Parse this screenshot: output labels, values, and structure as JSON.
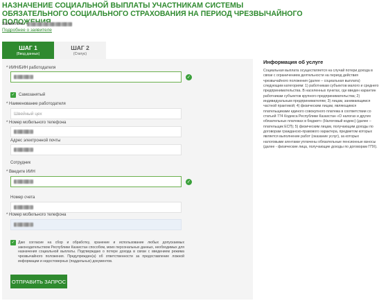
{
  "page": {
    "title": "НАЗНАЧЕНИЕ СОЦИАЛЬНОЙ ВЫПЛАТЫ УЧАСТНИКАМ СИСТЕМЫ ОБЯЗАТЕЛЬНОГО СОЦИАЛЬНОГО СТРАХОВАНИЯ НА ПЕРИОД ЧРЕЗВЫЧАЙНОГО ПОЛОЖЕНИЯ",
    "applicant_label": "Заявитель:",
    "more_link": "Подробнее о заявителе"
  },
  "tabs": [
    {
      "label": "ШАГ 1",
      "sub": "(Ввод данных)",
      "active": true
    },
    {
      "label": "ШАГ 2",
      "sub": "(Статус)",
      "active": false
    }
  ],
  "form": {
    "employer_iin_label": "ИИН/БИН работодателя",
    "self_employed_label": "Самозанятый",
    "employer_name_label": "Наименование работодателя",
    "employer_name_value": "Швейный цех",
    "employer_phone_label": "Номер мобильного телефона",
    "employer_email_label": "Адрес электронной почты",
    "employee_section": "Сотрудник",
    "iin_label": "Введите ИИН",
    "account_label": "Номер счета",
    "phone_label": "Номер мобильного телефона",
    "consent_text": "Даю согласие на сбор и обработку, хранение и использование любых допускаемых законодательством Республики Казахстан способом, моих персональных данных, необходимых для назначения социальной выплаты. Подтверждаю о потере дохода в связи с введением режима чрезвычайного положения. Предупрежден(а) об ответственности за предоставление ложной информации и недостоверных (поддельных) документов.",
    "submit_label": "ОТПРАВИТЬ ЗАПРОС"
  },
  "info": {
    "title": "Информация об услуге",
    "text": "Социальная выплата осуществляется на случай потери дохода в связи с ограничением деятельности на период действия чрезвычайного положения (далее – социальная выплата) следующим категориям: 1) работникам субъектов малого и среднего предпринимательства. В населенных пунктах, где введен карантин работникам субъектов крупного предпринимательства; 2) индивидуальным предпринимателям; 3) лицам, занимающимся частной практикой; 4) физическим лицам, являющимся плательщиками единого совокупного платежа в соответствии со статьей 774 Кодекса Республики Казахстан «О налогах и других обязательных платежах в бюджет» (Налоговый кодекс) (далее – плательщик ЕСП); 5) физическим лицам, получающим доходы по договорам гражданско-правового характера, предметом которых является выполнение работ (оказание услуг), за которых налоговыми агентами уплачены обязательные пенсионные взносы (далее - физические лица, получающие доходы по договорам ГПХ)."
  },
  "icons": {
    "valid": "check-circle-icon",
    "checkbox": "checkmark-icon"
  },
  "colors": {
    "accent": "#2f8a2f",
    "valid": "#3aa03a",
    "panel_bg": "#f4f4f4"
  }
}
